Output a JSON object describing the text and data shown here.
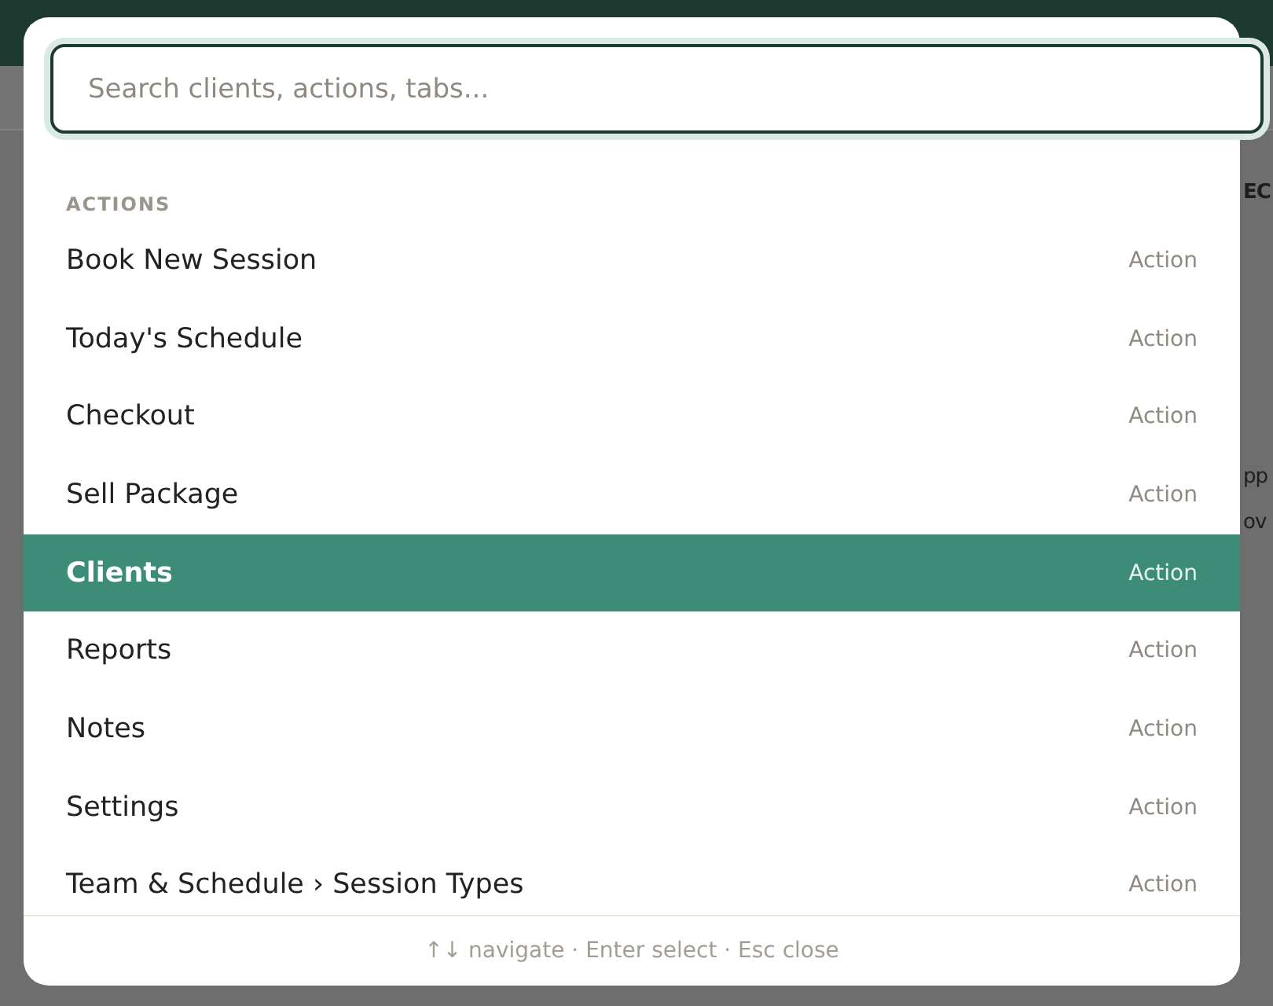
{
  "background": {
    "fragments": [
      {
        "text": "EC"
      },
      {
        "text": "pp"
      },
      {
        "text": "ov"
      }
    ]
  },
  "palette": {
    "search": {
      "placeholder": "Search clients, actions, tabs..."
    },
    "section": "ACTIONS",
    "items": [
      {
        "label": "Book New Session",
        "type": "Action",
        "selected": false
      },
      {
        "label": "Today's Schedule",
        "type": "Action",
        "selected": false
      },
      {
        "label": "Checkout",
        "type": "Action",
        "selected": false
      },
      {
        "label": "Sell Package",
        "type": "Action",
        "selected": false
      },
      {
        "label": "Clients",
        "type": "Action",
        "selected": true
      },
      {
        "label": "Reports",
        "type": "Action",
        "selected": false
      },
      {
        "label": "Notes",
        "type": "Action",
        "selected": false
      },
      {
        "label": "Settings",
        "type": "Action",
        "selected": false
      },
      {
        "label": "Team & Schedule › Session Types",
        "type": "Action",
        "selected": false
      }
    ],
    "footer": "↑↓ navigate · Enter select · Esc close"
  }
}
